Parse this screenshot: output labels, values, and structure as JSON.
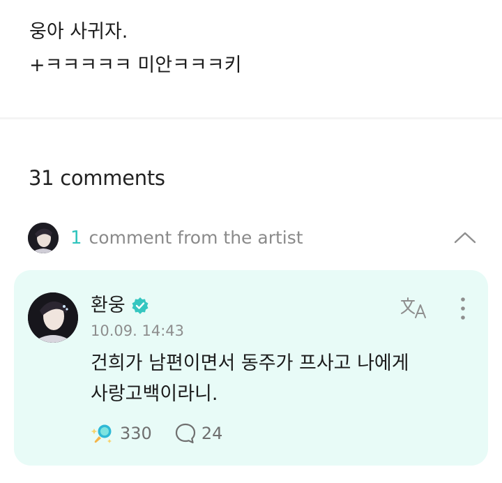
{
  "post": {
    "lines": [
      "웅아 사귀자.",
      "+ㅋㅋㅋㅋㅋ 미안ㅋㅋㅋ키"
    ]
  },
  "comments_header": {
    "count_label": "31 comments"
  },
  "artist_section": {
    "count": "1",
    "label": "comment from the artist",
    "toggle_icon": "chevron-up-icon"
  },
  "artist_comment": {
    "author": "환웅",
    "verified_icon": "verified-badge-icon",
    "timestamp": "10.09. 14:43",
    "body_lines": [
      "건희가 남편이면서 동주가 프사고 나에게",
      "사랑고백이라니."
    ],
    "reaction_count": "330",
    "reply_count": "24",
    "translate_icon": "translate-icon",
    "more_icon": "more-vertical-icon"
  },
  "colors": {
    "accent": "#2fc4bd",
    "card_bg": "#e8fbf7",
    "verified": "#35c6c0",
    "muted_text": "#8a8a8a"
  }
}
